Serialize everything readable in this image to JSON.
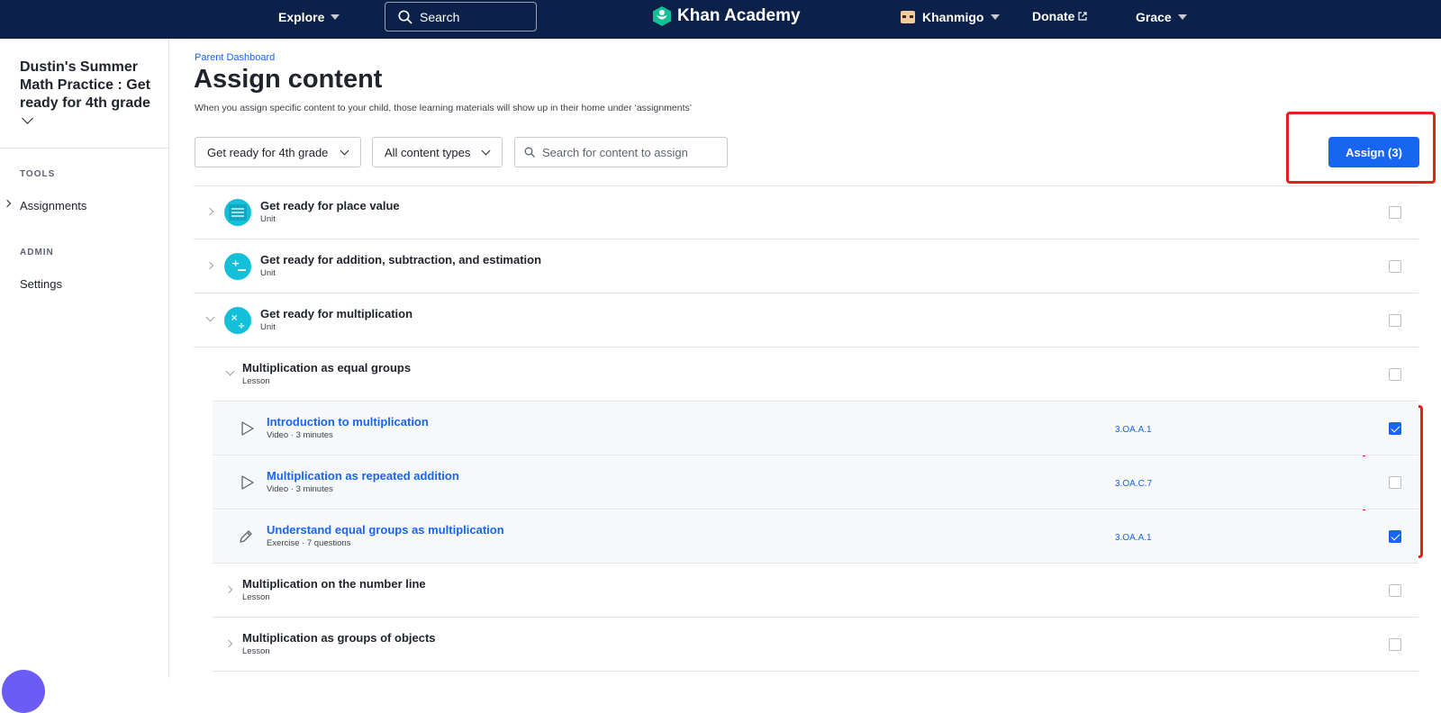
{
  "nav": {
    "explore": "Explore",
    "search_label": "Search",
    "logo_text": "Khan Academy",
    "khanmigo": "Khanmigo",
    "donate": "Donate",
    "user": "Grace"
  },
  "sidebar": {
    "course_title": "Dustin's Summer Math Practice : Get ready for 4th grade",
    "tools_heading": "TOOLS",
    "assignments": "Assignments",
    "admin_heading": "ADMIN",
    "settings": "Settings"
  },
  "main": {
    "breadcrumb": "Parent Dashboard",
    "title": "Assign content",
    "subtitle": "When you assign specific content to your child, those learning materials will show up in their home under ‘assignments’",
    "filter_grade": "Get ready for 4th grade",
    "filter_type": "All content types",
    "search_placeholder": "Search for content to assign",
    "assign_button": "Assign (3)"
  },
  "rows": [
    {
      "title": "Get ready for place value",
      "sub": "Unit",
      "std": "",
      "checked": false
    },
    {
      "title": "Get ready for addition, subtraction, and estimation",
      "sub": "Unit",
      "std": "",
      "checked": false
    },
    {
      "title": "Get ready for multiplication",
      "sub": "Unit",
      "std": "",
      "checked": false
    },
    {
      "title": "Multiplication as equal groups",
      "sub": "Lesson",
      "std": "",
      "checked": false
    },
    {
      "title": "Introduction to multiplication",
      "sub": "Video · 3 minutes",
      "std": "3.OA.A.1",
      "checked": true
    },
    {
      "title": "Multiplication as repeated addition",
      "sub": "Video · 3 minutes",
      "std": "3.OA.C.7",
      "checked": false
    },
    {
      "title": "Understand equal groups as multiplication",
      "sub": "Exercise · 7 questions",
      "std": "3.OA.A.1",
      "checked": true
    },
    {
      "title": "Multiplication on the number line",
      "sub": "Lesson",
      "std": "",
      "checked": false
    },
    {
      "title": "Multiplication as groups of objects",
      "sub": "Lesson",
      "std": "",
      "checked": false
    }
  ],
  "colors": {
    "nav_bg": "#0b2149",
    "link_blue": "#1865f2",
    "annotation_red": "#e6201c",
    "unit_icon_teal": "#14bfd9"
  }
}
